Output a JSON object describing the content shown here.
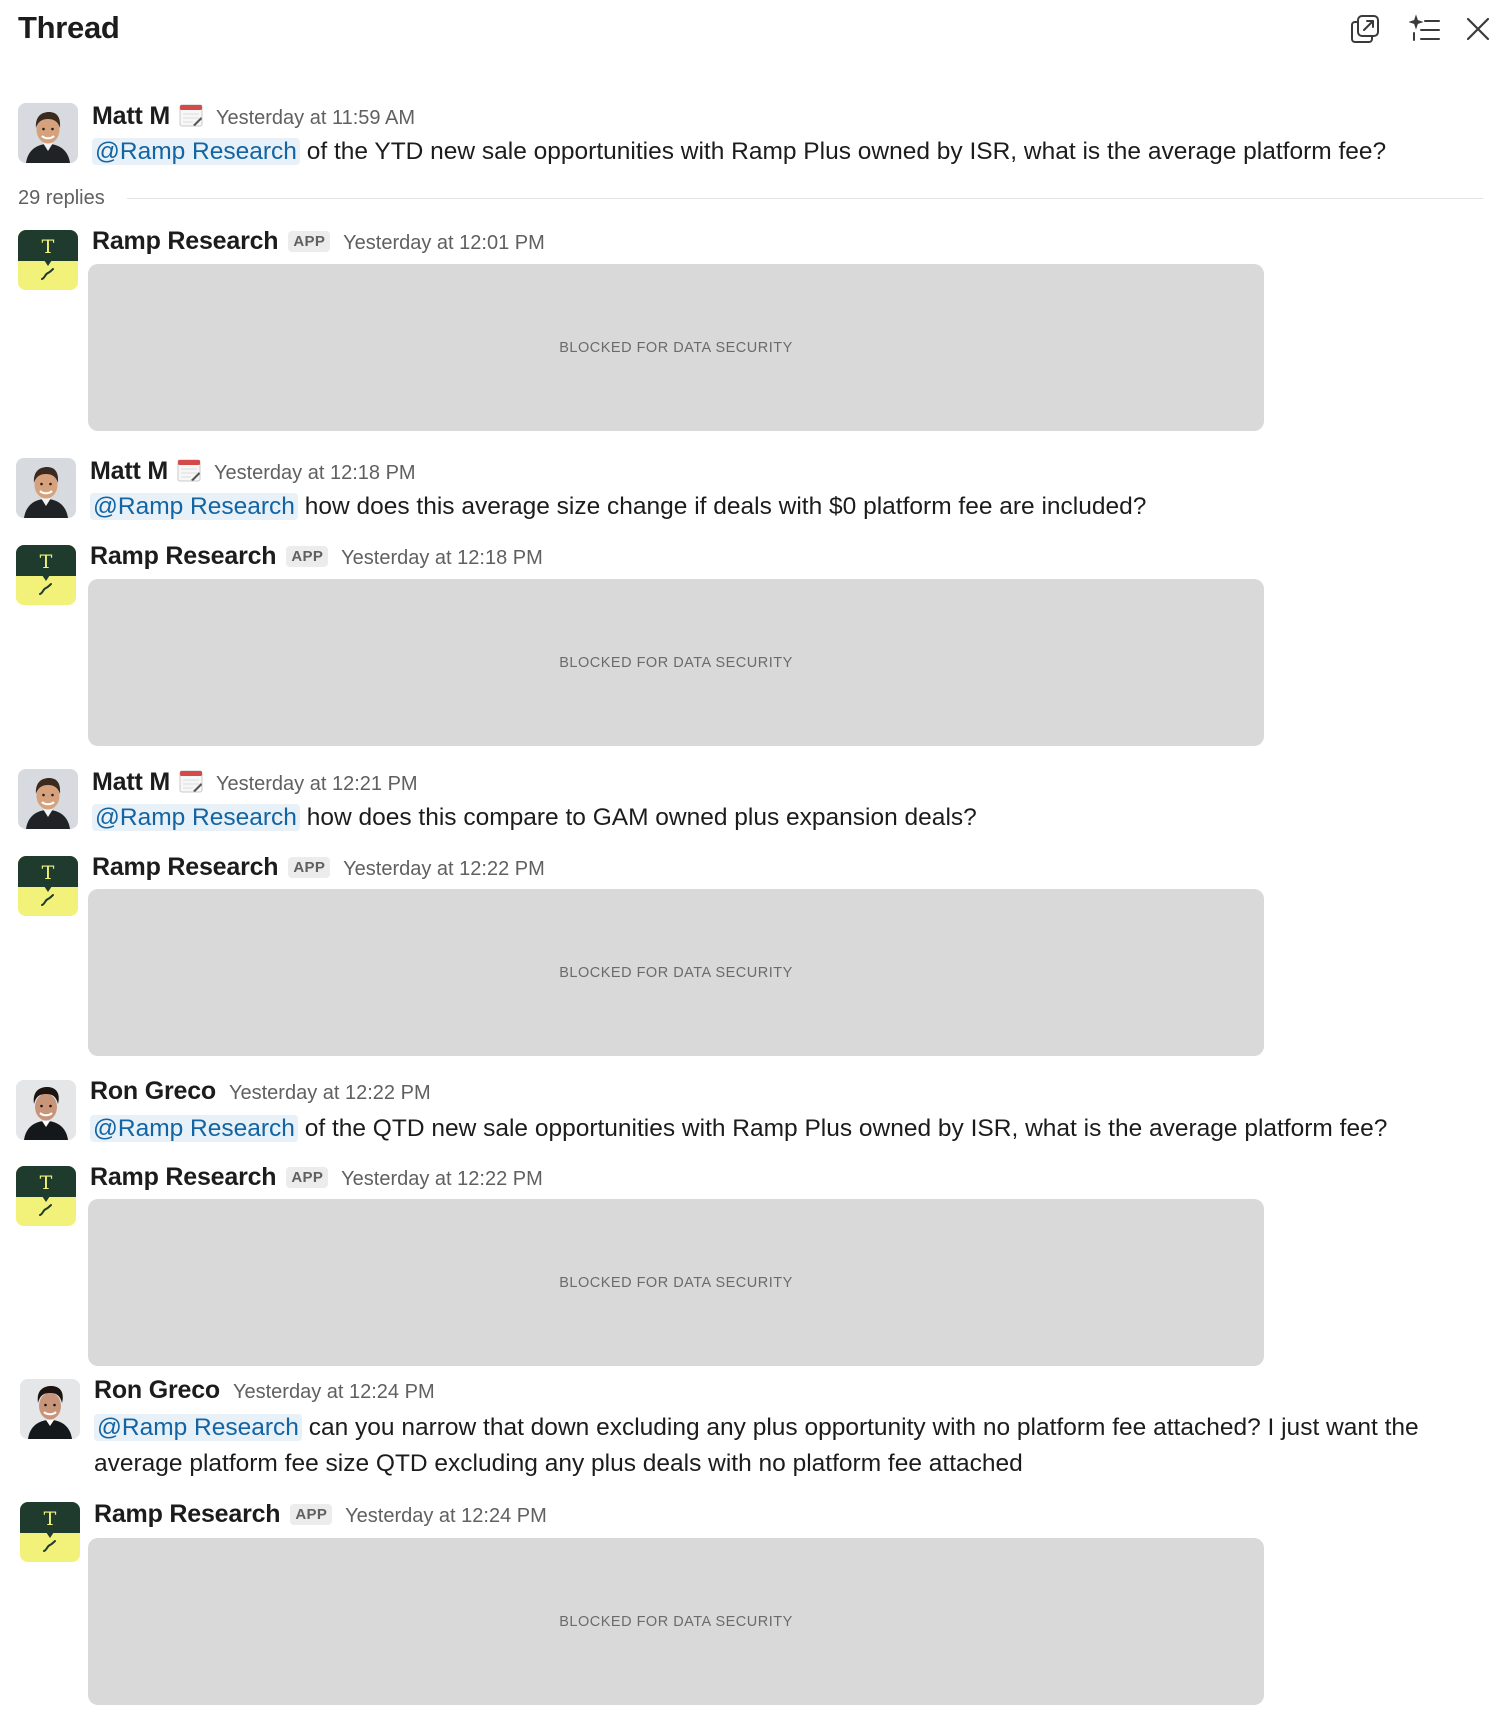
{
  "header": {
    "title": "Thread",
    "icons": [
      "open-in-window-icon",
      "ai-summary-icon",
      "close-icon"
    ]
  },
  "replies_label": "29 replies",
  "blocked_label": "BLOCKED FOR DATA SECURITY",
  "colors": {
    "mention_text": "#1264a3",
    "mention_bg": "#e8f0f8",
    "bot_avatar_top": "#1f3b2d",
    "bot_avatar_bottom": "#f2f27a",
    "blocked_bg": "#d9d9d9"
  },
  "messages": [
    {
      "author": "Matt M",
      "time": "Yesterday at 11:59 AM",
      "mention": "@Ramp Research",
      "text": "of the YTD new sale opportunities with Ramp Plus owned by ISR, what is the average platform fee?"
    },
    {
      "author": "Ramp Research",
      "badge": "APP",
      "time": "Yesterday at 12:01 PM"
    },
    {
      "author": "Matt M",
      "time": "Yesterday at 12:18 PM",
      "mention": "@Ramp Research",
      "text": "how does this average size change if deals with $0 platform fee are included?"
    },
    {
      "author": "Ramp Research",
      "badge": "APP",
      "time": "Yesterday at 12:18 PM"
    },
    {
      "author": "Matt M",
      "time": "Yesterday at 12:21 PM",
      "mention": "@Ramp Research",
      "text": "how does this compare to GAM owned plus expansion deals?"
    },
    {
      "author": "Ramp Research",
      "badge": "APP",
      "time": "Yesterday at 12:22 PM"
    },
    {
      "author": "Ron Greco",
      "time": "Yesterday at 12:22 PM",
      "mention": "@Ramp Research",
      "text": "of the QTD new sale opportunities with Ramp Plus owned by ISR, what is the average platform fee?"
    },
    {
      "author": "Ramp Research",
      "badge": "APP",
      "time": "Yesterday at 12:22 PM"
    },
    {
      "author": "Ron Greco",
      "time": "Yesterday at 12:24 PM",
      "mention": "@Ramp Research",
      "text_line1": "can you narrow that down excluding any plus opportunity with no platform fee attached? I just want the",
      "text_line2": "average platform fee size QTD excluding any plus deals with no platform fee attached"
    },
    {
      "author": "Ramp Research",
      "badge": "APP",
      "time": "Yesterday at 12:24 PM"
    }
  ]
}
